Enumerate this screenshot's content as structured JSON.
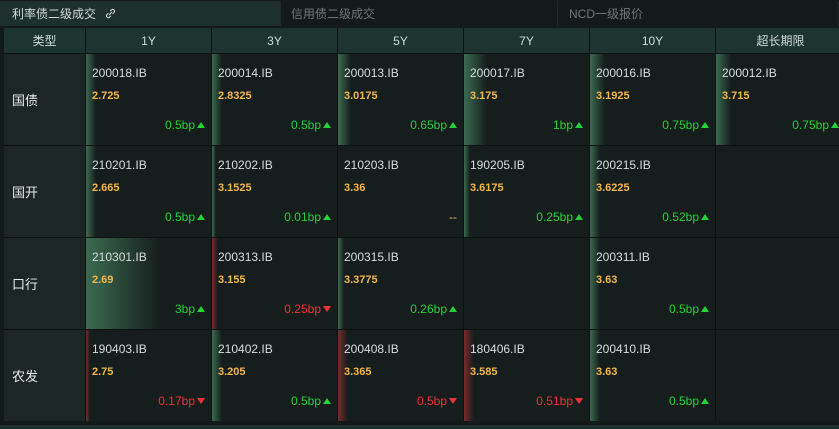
{
  "tabs": [
    {
      "label": "利率债二级成交",
      "active": true,
      "icon": "link-icon"
    },
    {
      "label": "信用债二级成交",
      "active": false
    },
    {
      "label": "NCD一级报价",
      "active": false
    }
  ],
  "table": {
    "corner": "类型",
    "columns": [
      "1Y",
      "3Y",
      "5Y",
      "7Y",
      "10Y",
      "超长期限"
    ],
    "rows": [
      {
        "label": "国债",
        "cells": [
          {
            "code": "200018.IB",
            "rate": "2.725",
            "change": "0.5bp",
            "dir": "up",
            "bar": 0.08
          },
          {
            "code": "200014.IB",
            "rate": "2.8325",
            "change": "0.5bp",
            "dir": "up",
            "bar": 0.08
          },
          {
            "code": "200013.IB",
            "rate": "3.0175",
            "change": "0.65bp",
            "dir": "up",
            "bar": 0.1
          },
          {
            "code": "200017.IB",
            "rate": "3.175",
            "change": "1bp",
            "dir": "up",
            "bar": 0.18
          },
          {
            "code": "200016.IB",
            "rate": "3.1925",
            "change": "0.75bp",
            "dir": "up",
            "bar": 0.12
          },
          {
            "code": "200012.IB",
            "rate": "3.715",
            "change": "0.75bp",
            "dir": "up",
            "bar": 0.12
          }
        ]
      },
      {
        "label": "国开",
        "cells": [
          {
            "code": "210201.IB",
            "rate": "2.665",
            "change": "0.5bp",
            "dir": "up",
            "bar": 0.08
          },
          {
            "code": "210202.IB",
            "rate": "3.1525",
            "change": "0.01bp",
            "dir": "up",
            "bar": 0.02
          },
          {
            "code": "210203.IB",
            "rate": "3.36",
            "change": "--",
            "dir": "flat",
            "bar": 0
          },
          {
            "code": "190205.IB",
            "rate": "3.6175",
            "change": "0.25bp",
            "dir": "up",
            "bar": 0.05
          },
          {
            "code": "200215.IB",
            "rate": "3.6225",
            "change": "0.52bp",
            "dir": "up",
            "bar": 0.08
          },
          null
        ]
      },
      {
        "label": "口行",
        "cells": [
          {
            "code": "210301.IB",
            "rate": "2.69",
            "change": "3bp",
            "dir": "up",
            "bar": 0.6
          },
          {
            "code": "200313.IB",
            "rate": "3.155",
            "change": "0.25bp",
            "dir": "down",
            "bar": 0.05
          },
          {
            "code": "200315.IB",
            "rate": "3.3775",
            "change": "0.26bp",
            "dir": "up",
            "bar": 0.05
          },
          null,
          {
            "code": "200311.IB",
            "rate": "3.63",
            "change": "0.5bp",
            "dir": "up",
            "bar": 0.08
          },
          null
        ]
      },
      {
        "label": "农发",
        "cells": [
          {
            "code": "190403.IB",
            "rate": "2.75",
            "change": "0.17bp",
            "dir": "down",
            "bar": 0.03
          },
          {
            "code": "210402.IB",
            "rate": "3.205",
            "change": "0.5bp",
            "dir": "up",
            "bar": 0.08
          },
          {
            "code": "200408.IB",
            "rate": "3.365",
            "change": "0.5bp",
            "dir": "down",
            "bar": 0.08
          },
          {
            "code": "180406.IB",
            "rate": "3.585",
            "change": "0.51bp",
            "dir": "down",
            "bar": 0.08
          },
          {
            "code": "200410.IB",
            "rate": "3.63",
            "change": "0.5bp",
            "dir": "up",
            "bar": 0.08
          },
          null
        ]
      }
    ]
  },
  "colors": {
    "up": "#27d13a",
    "down": "#f0323a",
    "rate": "#f5b74a",
    "up_bar": "#3b6b50",
    "down_bar": "#7a2b2b"
  }
}
